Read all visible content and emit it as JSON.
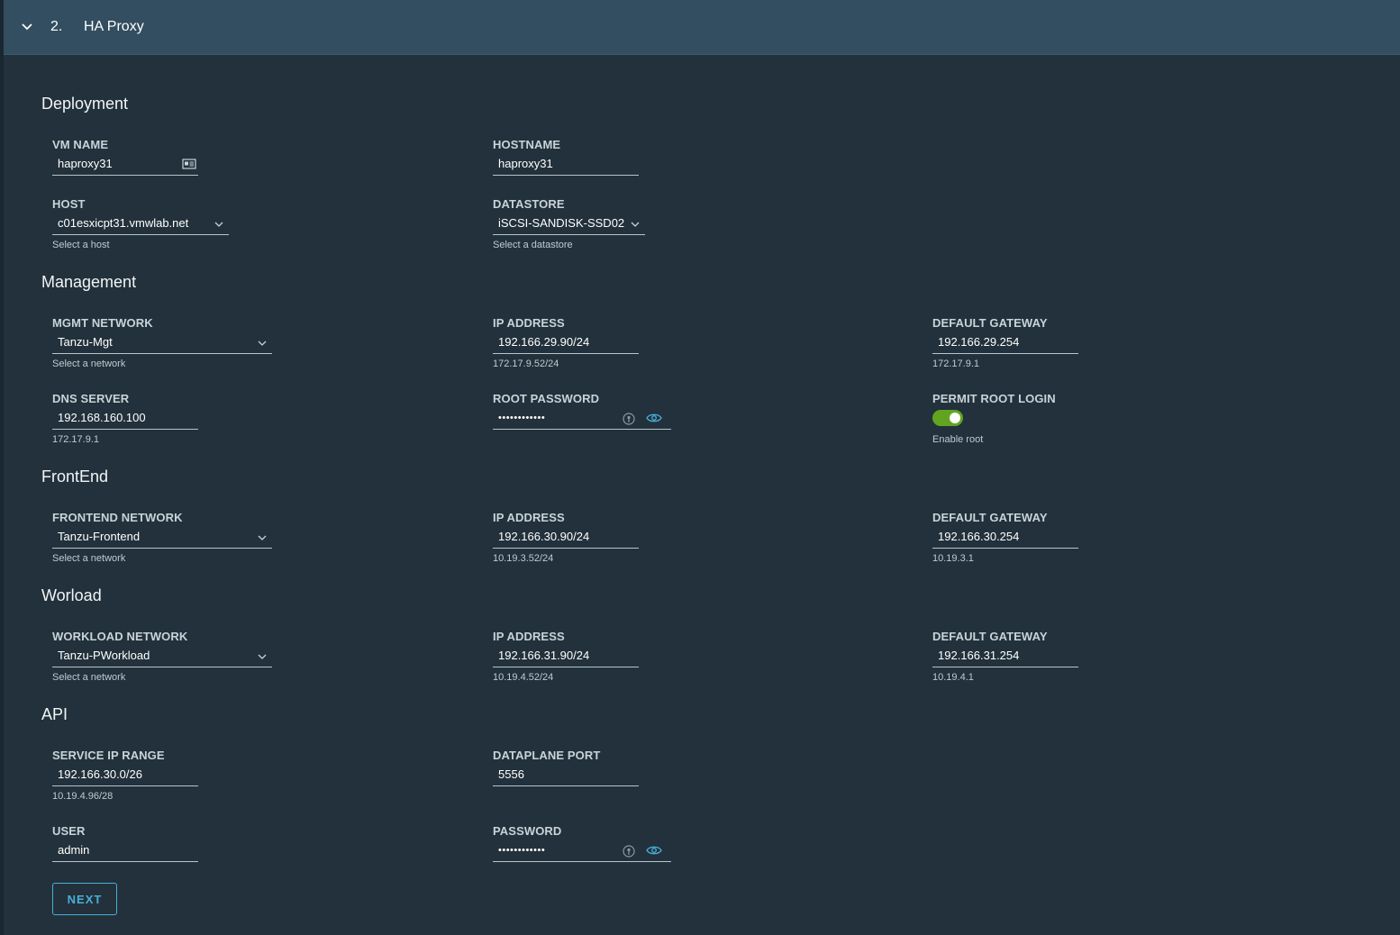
{
  "header": {
    "step": "2.",
    "title": "HA Proxy"
  },
  "sections": {
    "deployment": "Deployment",
    "management": "Management",
    "frontend": "FrontEnd",
    "workload": "Worload",
    "api": "API"
  },
  "deployment": {
    "vm_name": {
      "label": "VM NAME",
      "value": "haproxy31"
    },
    "hostname": {
      "label": "HOSTNAME",
      "value": "haproxy31"
    },
    "host": {
      "label": "HOST",
      "value": "c01esxicpt31.vmwlab.net",
      "helper": "Select a host"
    },
    "datastore": {
      "label": "DATASTORE",
      "value": "iSCSI-SANDISK-SSD02",
      "helper": "Select a datastore"
    }
  },
  "management": {
    "network": {
      "label": "MGMT NETWORK",
      "value": "Tanzu-Mgt",
      "helper": "Select a network"
    },
    "ip": {
      "label": "IP ADDRESS",
      "value": "192.166.29.90/24",
      "helper": "172.17.9.52/24"
    },
    "gateway": {
      "label": "DEFAULT GATEWAY",
      "value": "192.166.29.254",
      "helper": "172.17.9.1"
    },
    "dns": {
      "label": "DNS SERVER",
      "value": "192.168.160.100",
      "helper": "172.17.9.1"
    },
    "root_password": {
      "label": "ROOT PASSWORD",
      "value": "••••••••••••"
    },
    "permit_root": {
      "label": "PERMIT ROOT LOGIN",
      "helper": "Enable root",
      "enabled": true
    }
  },
  "frontend": {
    "network": {
      "label": "FRONTEND NETWORK",
      "value": "Tanzu-Frontend",
      "helper": "Select a network"
    },
    "ip": {
      "label": "IP ADDRESS",
      "value": "192.166.30.90/24",
      "helper": "10.19.3.52/24"
    },
    "gateway": {
      "label": "DEFAULT GATEWAY",
      "value": "192.166.30.254",
      "helper": "10.19.3.1"
    }
  },
  "workload": {
    "network": {
      "label": "WORKLOAD NETWORK",
      "value": "Tanzu-PWorkload",
      "helper": "Select a network"
    },
    "ip": {
      "label": "IP ADDRESS",
      "value": "192.166.31.90/24",
      "helper": "10.19.4.52/24"
    },
    "gateway": {
      "label": "DEFAULT GATEWAY",
      "value": "192.166.31.254",
      "helper": "10.19.4.1"
    }
  },
  "api": {
    "service_ip_range": {
      "label": "SERVICE IP RANGE",
      "value": "192.166.30.0/26",
      "helper": "10.19.4.96/28"
    },
    "dataplane_port": {
      "label": "DATAPLANE PORT",
      "value": "5556"
    },
    "user": {
      "label": "USER",
      "value": "admin"
    },
    "password": {
      "label": "PASSWORD",
      "value": "••••••••••••"
    }
  },
  "buttons": {
    "next": "NEXT"
  },
  "colors": {
    "accent": "#49afd9",
    "toggle_on": "#62a420",
    "header_bg": "#324e60",
    "page_bg": "#22313b"
  },
  "icons": [
    "chevron-down-icon",
    "id-card-icon",
    "key-icon",
    "eye-icon"
  ]
}
